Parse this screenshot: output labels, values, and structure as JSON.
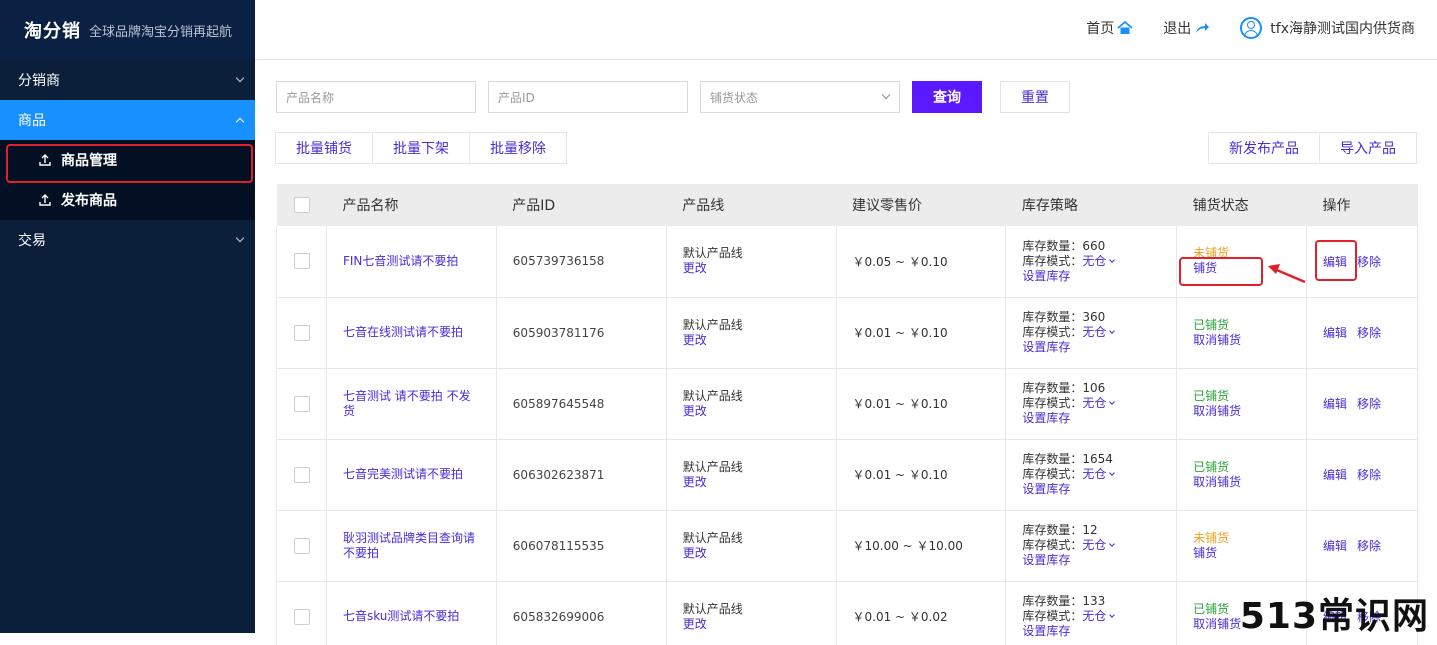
{
  "brand": {
    "logo": "淘分销",
    "slogan": "全球品牌淘宝分销再起航"
  },
  "header": {
    "home": "首页",
    "logout": "退出",
    "user": "tfx海静测试国内供货商"
  },
  "sidebar": {
    "groups": [
      {
        "label": "分销商"
      },
      {
        "label": "商品"
      },
      {
        "label": "交易"
      }
    ],
    "sub_items": [
      {
        "label": "商品管理"
      },
      {
        "label": "发布商品"
      }
    ]
  },
  "filters": {
    "name_placeholder": "产品名称",
    "id_placeholder": "产品ID",
    "status_placeholder": "铺货状态",
    "query": "查询",
    "reset": "重置"
  },
  "bulk_actions": {
    "distribute": "批量铺货",
    "off_shelf": "批量下架",
    "remove": "批量移除"
  },
  "right_actions": {
    "new_product": "新发布产品",
    "import": "导入产品"
  },
  "table": {
    "headers": [
      "产品名称",
      "产品ID",
      "产品线",
      "建议零售价",
      "库存策略",
      "铺货状态",
      "操作"
    ],
    "stock_qty_label": "库存数量：",
    "stock_mode_label": "库存模式：",
    "stock_mode_value": "无仓",
    "set_stock": "设置库存",
    "change": "更改",
    "edit": "编辑",
    "remove": "移除",
    "rows": [
      {
        "name": "FIN七音测试请不要拍",
        "id": "605739736158",
        "line": "默认产品线",
        "price": "￥0.05 ~ ￥0.10",
        "qty": "660",
        "status": "未铺货",
        "status_action": "铺货",
        "on": false
      },
      {
        "name": "七音在线测试请不要拍",
        "id": "605903781176",
        "line": "默认产品线",
        "price": "￥0.01 ~ ￥0.10",
        "qty": "360",
        "status": "已铺货",
        "status_action": "取消铺货",
        "on": true
      },
      {
        "name": "七音测试 请不要拍 不发货",
        "id": "605897645548",
        "line": "默认产品线",
        "price": "￥0.01 ~ ￥0.10",
        "qty": "106",
        "status": "已铺货",
        "status_action": "取消铺货",
        "on": true
      },
      {
        "name": "七音完美测试请不要拍",
        "id": "606302623871",
        "line": "默认产品线",
        "price": "￥0.01 ~ ￥0.10",
        "qty": "1654",
        "status": "已铺货",
        "status_action": "取消铺货",
        "on": true
      },
      {
        "name": "耿羽测试品牌类目查询请不要拍",
        "id": "606078115535",
        "line": "默认产品线",
        "price": "￥10.00 ~ ￥10.00",
        "qty": "12",
        "status": "未铺货",
        "status_action": "铺货",
        "on": false
      },
      {
        "name": "七音sku测试请不要拍",
        "id": "605832699006",
        "line": "默认产品线",
        "price": "￥0.01 ~ ￥0.02",
        "qty": "133",
        "status": "已铺货",
        "status_action": "取消铺货",
        "on": true
      }
    ]
  },
  "watermark": "513常识网",
  "colors": {
    "sidebar_bg": "#0b1f3b",
    "active_menu": "#1890ff",
    "primary": "#5b19ff",
    "link": "#4b2bd6",
    "on": "#2aa53a",
    "off": "#f0a020",
    "annotation": "#e0202a"
  }
}
